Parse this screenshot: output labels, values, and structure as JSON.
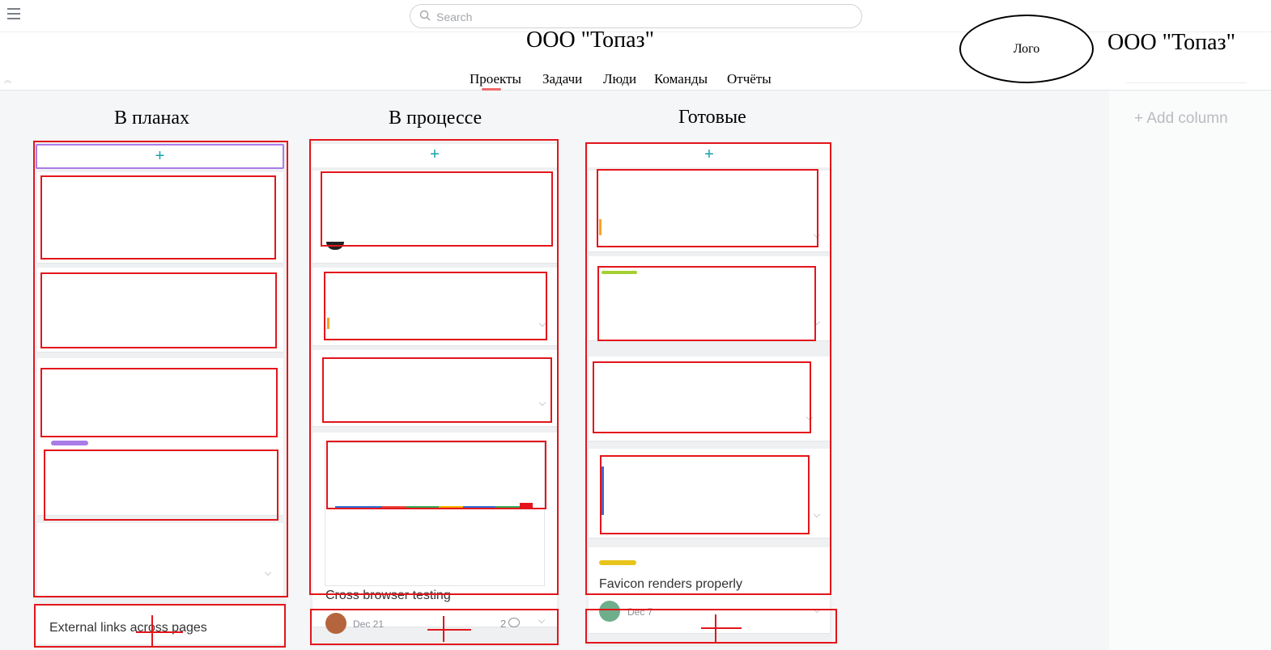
{
  "header": {
    "search_placeholder": "Search",
    "company_name": "ООО \"Топаз\"",
    "logo_label": "Лого",
    "nav": [
      "Проекты",
      "Задачи",
      "Люди",
      "Команды",
      "Отчёты"
    ],
    "active_nav": "Проекты"
  },
  "board": {
    "columns": [
      {
        "title": "В планах",
        "add_icon": "plus-icon"
      },
      {
        "title": "В процессе",
        "add_icon": "plus-icon"
      },
      {
        "title": "Готовые",
        "add_icon": "plus-icon"
      }
    ],
    "add_column_label": "+ Add column",
    "cards": {
      "external_links": {
        "title": "External links across pages"
      },
      "cross_browser": {
        "title": "Cross browser testing",
        "due": "Dec 21",
        "comment_count": "2"
      },
      "favicon": {
        "title": "Favicon renders properly",
        "due": "Dec 7"
      }
    }
  },
  "colors": {
    "accent_teal": "#13a1b0",
    "nav_underline": "#f06a6a",
    "annotation_red": "#e3151b",
    "tag_purple": "#a97ce8",
    "tag_green": "#a4cf30",
    "tag_yellow": "#e8c41a"
  },
  "icons": {
    "menu": "hamburger-icon",
    "search": "search-icon",
    "comment": "comment-bubble-icon",
    "chevron": "chevron-down-icon"
  }
}
